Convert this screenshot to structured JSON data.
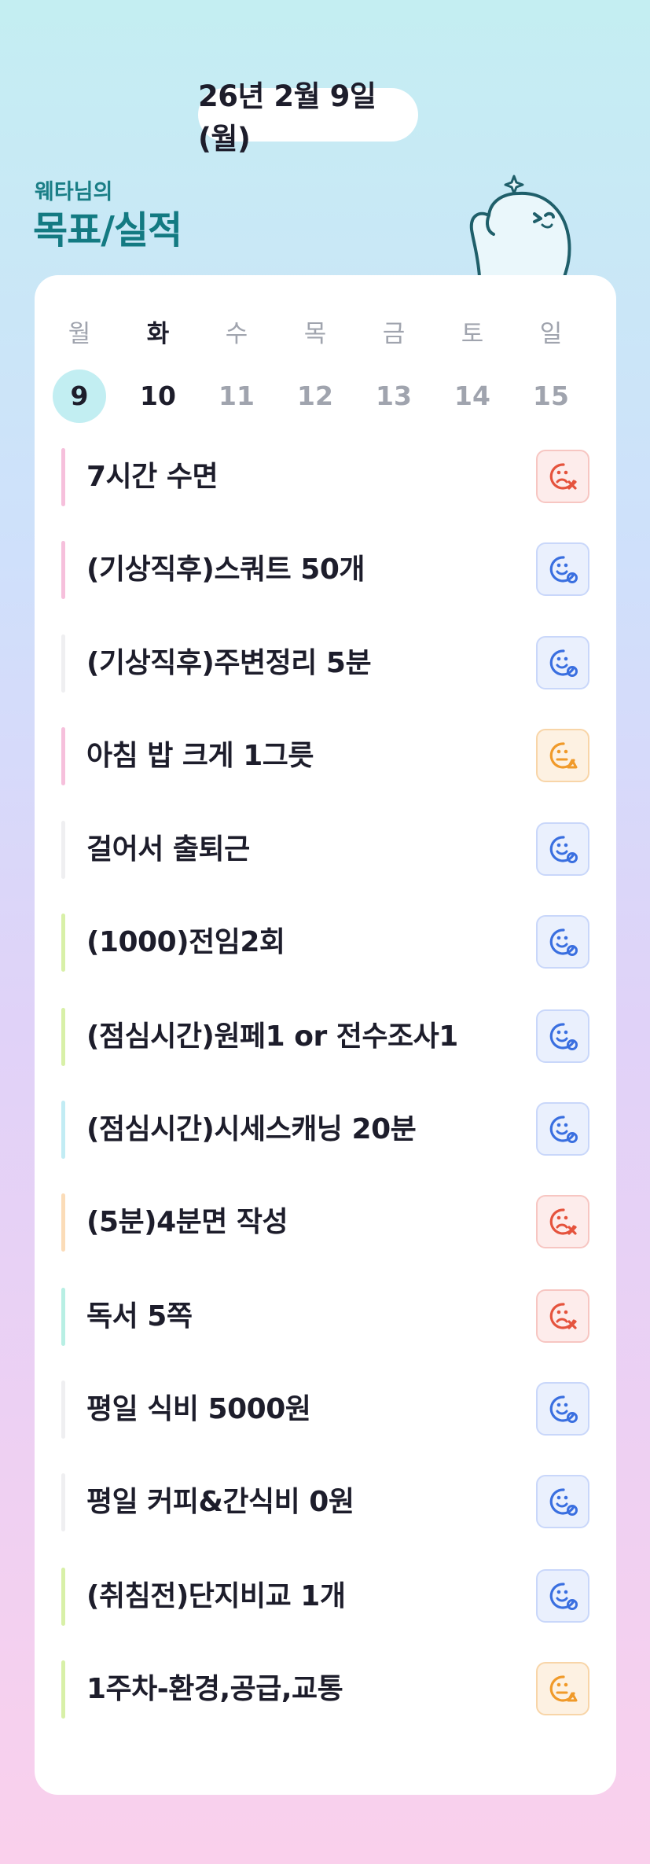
{
  "header": {
    "date": "26년 2월 9일(월)",
    "subtitle": "웨타님의",
    "title": "목표/실적"
  },
  "week": [
    {
      "name": "월",
      "num": "9",
      "state": "selected"
    },
    {
      "name": "화",
      "num": "10",
      "state": "today"
    },
    {
      "name": "수",
      "num": "11",
      "state": "future"
    },
    {
      "name": "목",
      "num": "12",
      "state": "future"
    },
    {
      "name": "금",
      "num": "13",
      "state": "future"
    },
    {
      "name": "토",
      "num": "14",
      "state": "future"
    },
    {
      "name": "일",
      "num": "15",
      "state": "future"
    }
  ],
  "goals": [
    {
      "text": "7시간 수면",
      "bar": "#f6c0dc",
      "status": "fail"
    },
    {
      "text": "(기상직후)스쿼트 50개",
      "bar": "#f6c0dc",
      "status": "done"
    },
    {
      "text": "(기상직후)주변정리 5분",
      "bar": "#efeff1",
      "status": "done"
    },
    {
      "text": "아침 밥 크게 1그릇",
      "bar": "#f6c0dc",
      "status": "partial"
    },
    {
      "text": "걸어서 출퇴근",
      "bar": "#efeff1",
      "status": "done"
    },
    {
      "text": "(1000)전임2회",
      "bar": "#d8f0a8",
      "status": "done"
    },
    {
      "text": "(점심시간)원페1 or 전수조사1",
      "bar": "#d8f0a8",
      "status": "done"
    },
    {
      "text": "(점심시간)시세스캐닝 20분",
      "bar": "#c2ecf4",
      "status": "done"
    },
    {
      "text": "(5분)4분면 작성",
      "bar": "#fbdcb8",
      "status": "fail"
    },
    {
      "text": "독서 5쪽",
      "bar": "#b8efe4",
      "status": "fail"
    },
    {
      "text": "평일 식비 5000원",
      "bar": "#efeff1",
      "status": "done"
    },
    {
      "text": "평일 커피&간식비 0원",
      "bar": "#efeff1",
      "status": "done"
    },
    {
      "text": "(취침전)단지비교 1개",
      "bar": "#d8f0a8",
      "status": "done"
    },
    {
      "text": "1주차-환경,공급,교통",
      "bar": "#d8f0a8",
      "status": "partial"
    }
  ],
  "status_icons": {
    "fail": {
      "icon": "sad-face-x-icon",
      "color": "#e5533d"
    },
    "done": {
      "icon": "smile-face-check-icon",
      "color": "#3a6fe0"
    },
    "partial": {
      "icon": "meh-face-triangle-icon",
      "color": "#f09a2a"
    }
  }
}
